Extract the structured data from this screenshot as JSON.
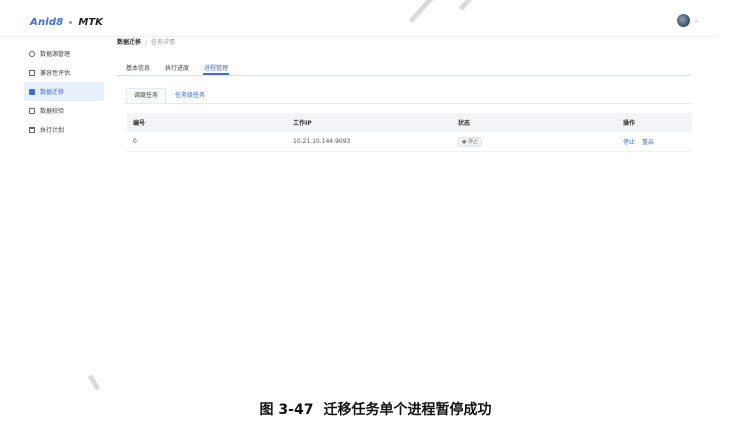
{
  "header": {
    "brand": "Anld8",
    "product": "MTK",
    "avatar_caret": "⌄"
  },
  "sidebar": {
    "items": [
      {
        "label": "数据源管理",
        "icon": "database-icon",
        "active": false
      },
      {
        "label": "兼容性评估",
        "icon": "assessment-icon",
        "active": false
      },
      {
        "label": "数据迁移",
        "icon": "folder-icon",
        "active": true
      },
      {
        "label": "数据校验",
        "icon": "check-icon",
        "active": false
      },
      {
        "label": "执行计划",
        "icon": "calendar-icon",
        "active": false
      }
    ]
  },
  "breadcrumb": {
    "root": "数据迁移",
    "current": "任务详情"
  },
  "tabs": [
    {
      "label": "基本信息",
      "active": false
    },
    {
      "label": "执行进度",
      "active": false
    },
    {
      "label": "进程管理",
      "active": true
    }
  ],
  "subtabs": [
    {
      "label": "调度任务",
      "active": false
    },
    {
      "label": "任务级任务",
      "active": true
    }
  ],
  "table": {
    "headers": [
      "编号",
      "工作IP",
      "状态",
      "操作"
    ],
    "rows": [
      {
        "id": "0",
        "ip": "10.21.10.144:9093",
        "status": "● 停止",
        "actions": [
          "停止",
          "重启"
        ]
      }
    ]
  },
  "caption": {
    "number": "图 3-47",
    "text": "迁移任务单个进程暂停成功"
  },
  "colors": {
    "accent": "#3d6fd8",
    "active_bg": "#e8effd",
    "table_header_bg": "#f2f4f7"
  }
}
